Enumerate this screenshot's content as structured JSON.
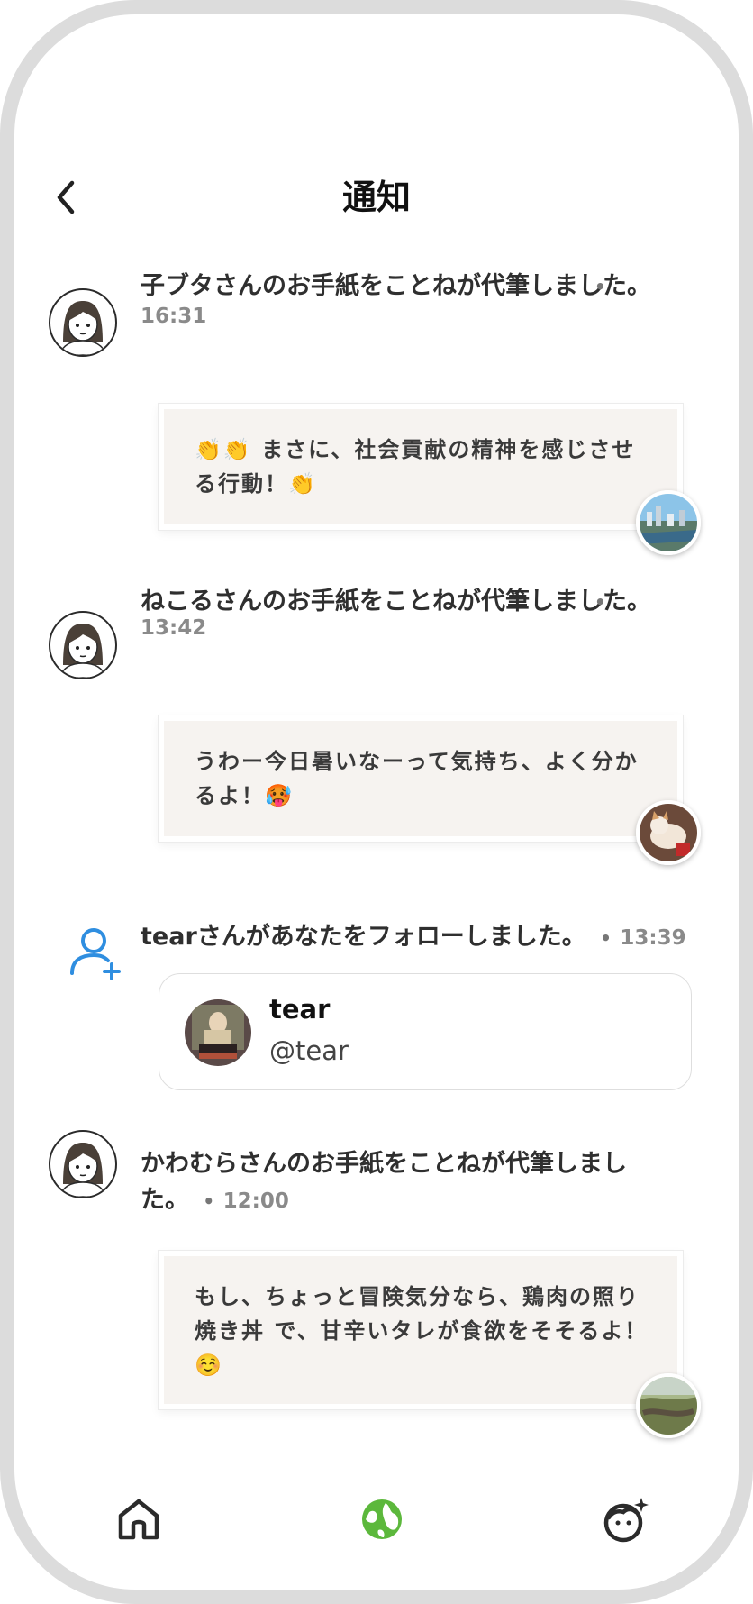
{
  "header": {
    "title": "通知"
  },
  "notifications": [
    {
      "text": "子ブタさんのお手紙をことねが代筆しました。",
      "dot": "•",
      "time": "16:31",
      "message": "👏👏 まさに、社会貢献の精神を感じさせる行動！👏"
    },
    {
      "text": "ねこるさんのお手紙をことねが代筆しました。",
      "dot": "•",
      "time": "13:42",
      "message": "うわー今日暑いなーって気持ち、よく分かるよ！🥵"
    },
    {
      "text": "tearさんがあなたをフォローしました。",
      "dot": "•",
      "time": "13:39",
      "user": {
        "name": "tear",
        "handle": "@tear"
      }
    },
    {
      "text_line1": "かわむらさんのお手紙をことねが代筆しまし",
      "text_line2": "た。",
      "dot": "•",
      "time": "12:00",
      "message": "もし、ちょっと冒険気分なら、鶏肉の照り焼き丼 で、甘辛いタレが食欲をそそるよ！☺️"
    }
  ],
  "nav": {
    "items": [
      "home-icon",
      "globe-icon",
      "face-sparkle-icon"
    ],
    "active_color": "#5cb83c"
  }
}
